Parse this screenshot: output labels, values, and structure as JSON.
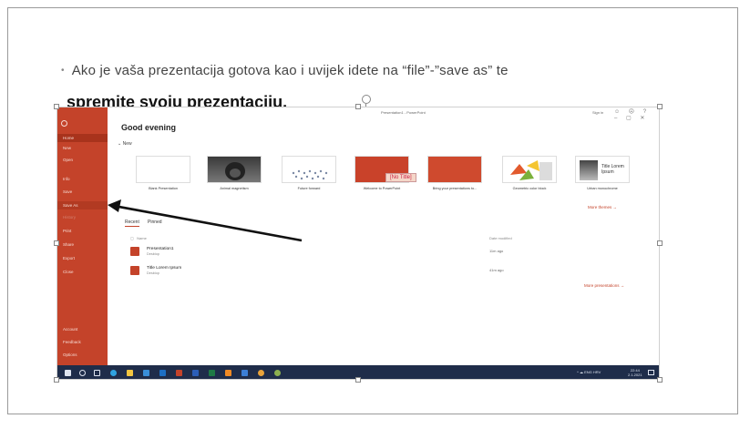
{
  "slide": {
    "bullet": "Ako je vaša prezentacija gotova kao i uvijek idete na “file”-”save as” te",
    "heading": "spremite svoju prezentaciju."
  },
  "app": {
    "window_title": "Presentation1 - PowerPoint",
    "signin": "Sign in",
    "greeting": "Good evening",
    "new_section": "New",
    "window_controls": "☺ ☹ ?  –  ▢  ✕"
  },
  "sidebar": {
    "items": [
      {
        "label": "Home"
      },
      {
        "label": "New"
      },
      {
        "label": "Open"
      },
      {
        "label": "Info"
      },
      {
        "label": "Save"
      },
      {
        "label": "Save As"
      },
      {
        "label": "History"
      },
      {
        "label": "Print"
      },
      {
        "label": "Share"
      },
      {
        "label": "Export"
      },
      {
        "label": "Close"
      },
      {
        "label": "Account"
      },
      {
        "label": "Feedback"
      },
      {
        "label": "Options"
      }
    ]
  },
  "templates": [
    {
      "label": "Blank Presentation"
    },
    {
      "label": "Animal magnetism"
    },
    {
      "label": "Future forward"
    },
    {
      "label": "Welcome to PowerPoint"
    },
    {
      "label": "Bring your presentations to..."
    },
    {
      "label": "Geometric color block"
    },
    {
      "label": "Urban monochrome"
    }
  ],
  "thumb_inner": {
    "urban": "Title Lorem Ipsum"
  },
  "no_title_tag": "[No Title]",
  "more_themes": "More themes →",
  "tabs": {
    "recent": "Recent",
    "pinned": "Pinned"
  },
  "columns": {
    "name": "Name",
    "date": "Date modified"
  },
  "files": [
    {
      "name": "Presentation1",
      "location": "Desktop",
      "date": "11m ago"
    },
    {
      "name": "Title Lorem Ipsum",
      "location": "Desktop",
      "date": "41m ago"
    }
  ],
  "more_presentations": "More presentations →",
  "taskbar": {
    "tray": "^  ☁  ENG  HRV",
    "time": "22:44",
    "date": "2.1.2021"
  },
  "colors": {
    "accent": "#c4432a",
    "taskbar": "#1f2d4a",
    "arrow": "#111111"
  },
  "icons": [
    "windows-start-icon",
    "search-icon",
    "task-view-icon",
    "edge-icon",
    "explorer-icon",
    "store-icon",
    "outlook-icon",
    "powerpoint-icon",
    "word-icon",
    "excel-icon",
    "vlc-icon",
    "chrome-icon",
    "teams-icon",
    "settings-icon"
  ]
}
